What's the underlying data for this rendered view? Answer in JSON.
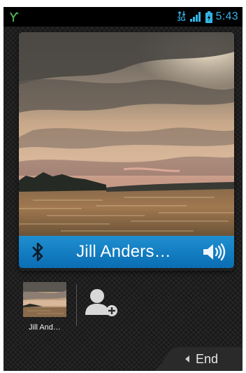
{
  "status_bar": {
    "network_type": "3G",
    "time": "5:43"
  },
  "call": {
    "caller_name": "Jill Anders…",
    "contact_short_name": "Jill And…",
    "end_label": "End"
  },
  "icons": {
    "status": [
      "notification-icon",
      "data-transfer-icon",
      "signal-icon",
      "battery-icon"
    ],
    "call_bar": [
      "bluetooth-icon",
      "speaker-icon"
    ],
    "actions": [
      "add-contact-icon",
      "chevron-left-icon"
    ]
  },
  "colors": {
    "accent_blue": "#0a6db3",
    "status_blue": "#33b5e5"
  }
}
